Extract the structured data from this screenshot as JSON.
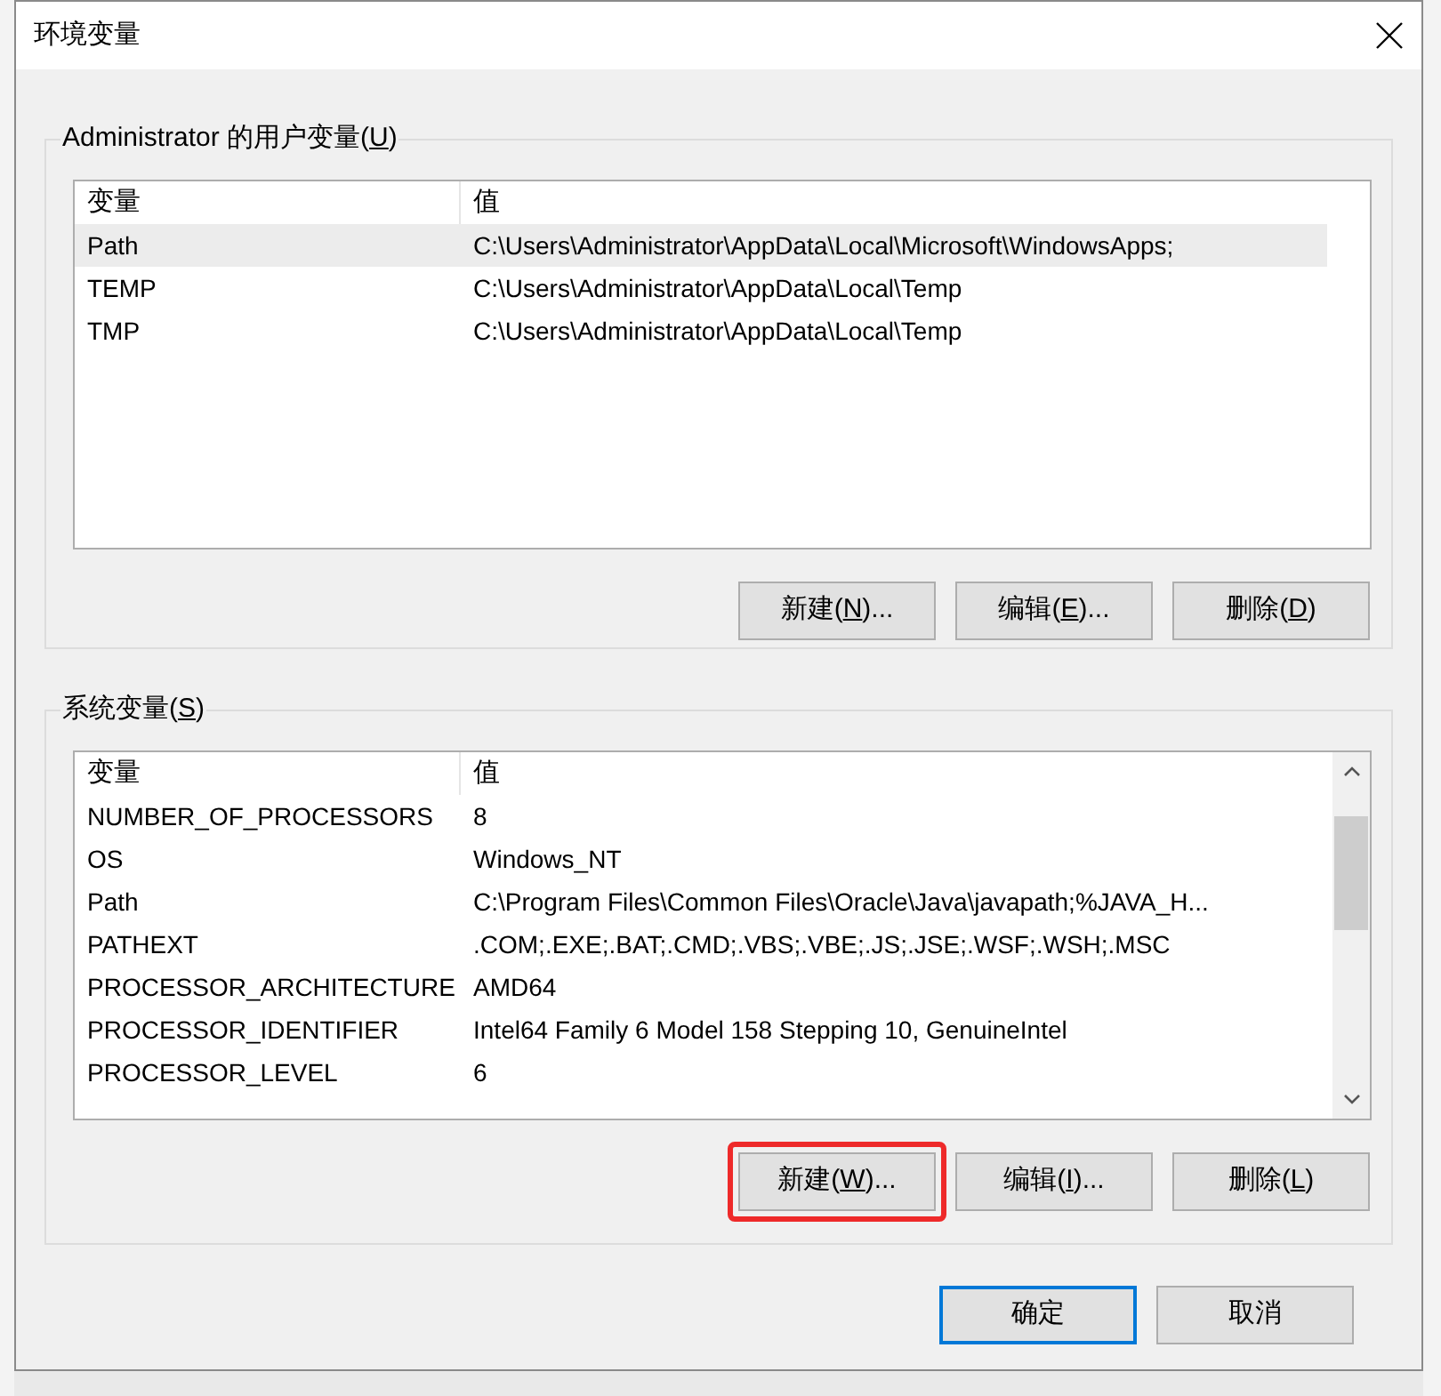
{
  "window": {
    "title": "环境变量"
  },
  "user_variables": {
    "title": {
      "before": "Administrator 的用户变量(",
      "key": "U",
      "after": ")"
    },
    "columns": [
      "变量",
      "值"
    ],
    "rows": [
      {
        "name": "Path",
        "value": "C:\\Users\\Administrator\\AppData\\Local\\Microsoft\\WindowsApps;",
        "selected": true
      },
      {
        "name": "TEMP",
        "value": "C:\\Users\\Administrator\\AppData\\Local\\Temp",
        "selected": false
      },
      {
        "name": "TMP",
        "value": "C:\\Users\\Administrator\\AppData\\Local\\Temp",
        "selected": false
      }
    ],
    "buttons": [
      {
        "before": "新建(",
        "key": "N",
        "after": ")...",
        "highlighted": false
      },
      {
        "before": "编辑(",
        "key": "E",
        "after": ")...",
        "highlighted": false
      },
      {
        "before": "删除(",
        "key": "D",
        "after": ")",
        "highlighted": false
      }
    ]
  },
  "system_variables": {
    "title": {
      "before": "系统变量(",
      "key": "S",
      "after": ")"
    },
    "columns": [
      "变量",
      "值"
    ],
    "rows": [
      {
        "name": "NUMBER_OF_PROCESSORS",
        "value": "8",
        "selected": false
      },
      {
        "name": "OS",
        "value": "Windows_NT",
        "selected": false
      },
      {
        "name": "Path",
        "value": "C:\\Program Files\\Common Files\\Oracle\\Java\\javapath;%JAVA_H...",
        "selected": false
      },
      {
        "name": "PATHEXT",
        "value": ".COM;.EXE;.BAT;.CMD;.VBS;.VBE;.JS;.JSE;.WSF;.WSH;.MSC",
        "selected": false
      },
      {
        "name": "PROCESSOR_ARCHITECTURE",
        "value": "AMD64",
        "selected": false
      },
      {
        "name": "PROCESSOR_IDENTIFIER",
        "value": "Intel64 Family 6 Model 158 Stepping 10, GenuineIntel",
        "selected": false
      },
      {
        "name": "PROCESSOR_LEVEL",
        "value": "6",
        "selected": false
      }
    ],
    "buttons": [
      {
        "before": "新建(",
        "key": "W",
        "after": ")...",
        "highlighted": true
      },
      {
        "before": "编辑(",
        "key": "I",
        "after": ")...",
        "highlighted": false
      },
      {
        "before": "删除(",
        "key": "L",
        "after": ")",
        "highlighted": false
      }
    ]
  },
  "dialog_buttons": [
    {
      "label": "确定",
      "default": true
    },
    {
      "label": "取消",
      "default": false
    }
  ]
}
